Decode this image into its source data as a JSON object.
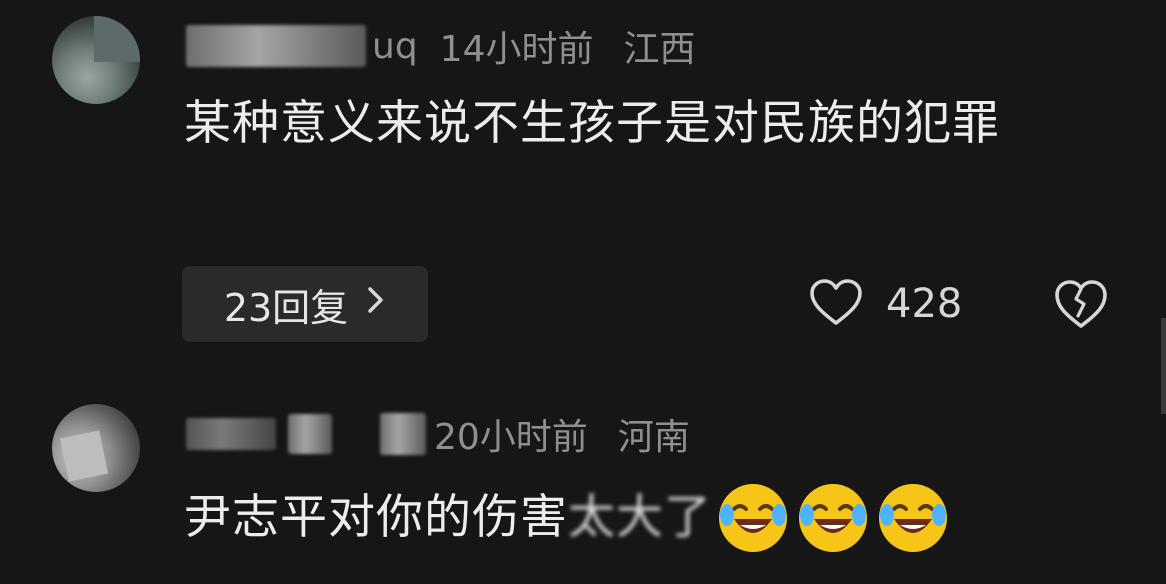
{
  "comments": [
    {
      "username_visible": "uq",
      "time": "14小时前",
      "location": "江西",
      "text": "某种意义来说不生孩子是对民族的犯罪",
      "reply_label": "23回复",
      "reply_icon": "chevron-right-icon",
      "likes": "428",
      "like_icon": "heart-outline-icon",
      "dislike_icon": "broken-heart-icon"
    },
    {
      "username_visible": "",
      "time": "20小时前",
      "location": "河南",
      "text": "尹志平对你的伤害",
      "text_blurred": "太大了",
      "emoji": [
        "laughing-tears-emoji",
        "laughing-tears-emoji",
        "laughing-tears-emoji"
      ]
    }
  ],
  "colors": {
    "background": "#161616",
    "text": "#ececec",
    "meta": "#8f8f8f",
    "reply_button_bg": "#2a2a2a",
    "emoji_yellow": "#f5c518"
  }
}
